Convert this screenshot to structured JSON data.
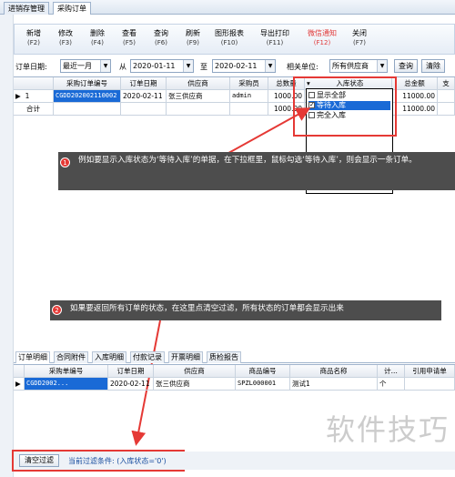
{
  "tabs": [
    "进销存管理",
    "采购订单"
  ],
  "toolbar": {
    "buttons": [
      {
        "label": "新增",
        "key": "(F2)"
      },
      {
        "label": "修改",
        "key": "(F3)"
      },
      {
        "label": "删除",
        "key": "(F4)"
      },
      {
        "label": "查看",
        "key": "(F5)"
      },
      {
        "label": "查询",
        "key": "(F6)"
      },
      {
        "label": "刷新",
        "key": "(F9)"
      },
      {
        "label": "图形报表",
        "key": "(F10)"
      },
      {
        "label": "导出打印",
        "key": "(F11)"
      },
      {
        "label": "微信通知",
        "key": "(F12)"
      },
      {
        "label": "关闭",
        "key": "(F7)"
      }
    ]
  },
  "filter": {
    "date_label": "订单日期:",
    "range_value": "最近一月",
    "from_label": "从",
    "from_date": "2020-01-11",
    "to_label": "至",
    "to_date": "2020-02-11",
    "unit_label": "相关单位:",
    "unit_value": "所有供应商",
    "query_button": "查询",
    "clear_button": "清除"
  },
  "grid": {
    "headers": [
      "采购订单编号",
      "订单日期",
      "供应商",
      "采购员",
      "总数量",
      "入库状态",
      "总金额",
      "支"
    ],
    "rows": [
      {
        "index": "1",
        "order_no": "CGDD202002110002",
        "date": "2020-02-11",
        "supplier": "张三供应商",
        "buyer": "admin",
        "qty": "1000.00",
        "amount": "11000.00"
      }
    ],
    "total_label": "合计",
    "total_qty": "1000.00",
    "total_amount": "11000.00"
  },
  "dropdown": {
    "header_arrow": "▾",
    "items": [
      {
        "label": "显示全部",
        "checked": false
      },
      {
        "label": "等待入库",
        "checked": true
      },
      {
        "label": "完全入库",
        "checked": false
      }
    ]
  },
  "callouts": {
    "one_number": "1",
    "one_text": "例如要显示入库状态为‘等待入库’的单据，在下拉框里，鼠标勾选‘等待入库’，则会显示一条订单。",
    "two_number": "2",
    "two_text": "如果要返回所有订单的状态，在这里点清空过滤，所有状态的订单都会显示出来"
  },
  "bottom_tabs": [
    "订单明细",
    "合同附件",
    "入库明细",
    "付款记录",
    "开票明细",
    "质检报告"
  ],
  "detail": {
    "headers": [
      "采购单编号",
      "订单日期",
      "供应商",
      "商品编号",
      "商品名称",
      "计...",
      "引用申请单"
    ],
    "rows": [
      {
        "order_no": "CGDD2002...",
        "date": "2020-02-11",
        "supplier": "张三供应商",
        "sku": "SPZL000001",
        "name": "测试1",
        "unit": "个"
      }
    ]
  },
  "status": {
    "clear_filter": "清空过滤",
    "current_filter": "当前过滤条件: (入库状态='0')"
  },
  "watermark": "软件技巧",
  "colors": {
    "accent": "#1a6ad6",
    "highlight_red": "#e53935",
    "wechat_red": "#e03a3a"
  }
}
